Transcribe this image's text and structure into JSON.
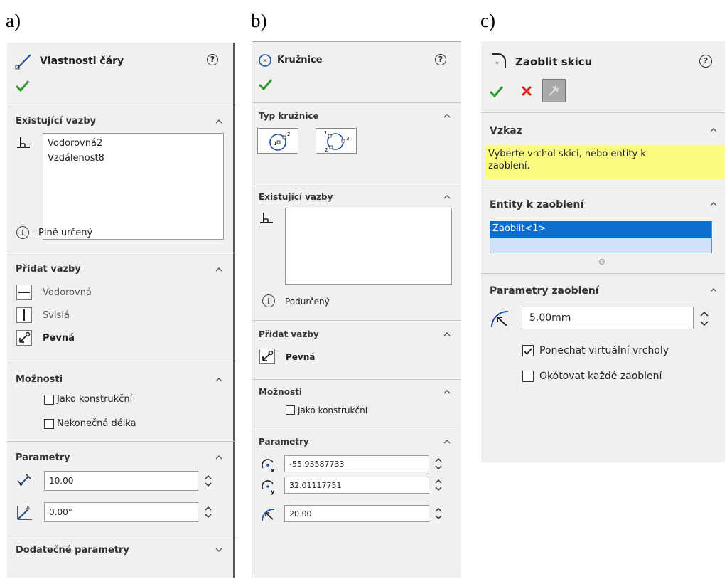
{
  "labels": {
    "a": "a)",
    "b": "b)",
    "c": "c)"
  },
  "panel_a": {
    "title": "Vlastnosti čáry",
    "existing_title": "Existující vazby",
    "existing_items": [
      "Vodorovná2",
      "Vzdálenost8"
    ],
    "status": "Plně určený",
    "add_title": "Přidat vazby",
    "add_items": {
      "horizontal": "Vodorovná",
      "vertical": "Svislá",
      "fixed": "Pevná"
    },
    "options_title": "Možnosti",
    "opt_construction": "Jako konstrukční",
    "opt_infinite": "Nekonečná délka",
    "params_title": "Parametry",
    "length_value": "10.00",
    "angle_value": "0.00°",
    "extra_title": "Dodatečné parametry"
  },
  "panel_b": {
    "title": "Kružnice",
    "type_title": "Typ kružnice",
    "existing_title": "Existující vazby",
    "status": "Podurčený",
    "add_title": "Přidat vazby",
    "fixed": "Pevná",
    "options_title": "Možnosti",
    "opt_construction": "Jako konstrukční",
    "params_title": "Parametry",
    "x_value": "-55.93587733",
    "y_value": "32.01117751",
    "radius_value": "20.00"
  },
  "panel_c": {
    "title": "Zaoblit skicu",
    "message_title": "Vzkaz",
    "message": "Vyberte vrchol skici, nebo entity k zaoblení.",
    "entities_title": "Entity k zaoblení",
    "entity_item": "Zaoblit<1>",
    "params_title": "Parametry zaoblení",
    "radius_value": "5.00mm",
    "opt_keep": "Ponechat virtuální vrcholy",
    "opt_dim": "Okótovat každé zaoblení"
  }
}
